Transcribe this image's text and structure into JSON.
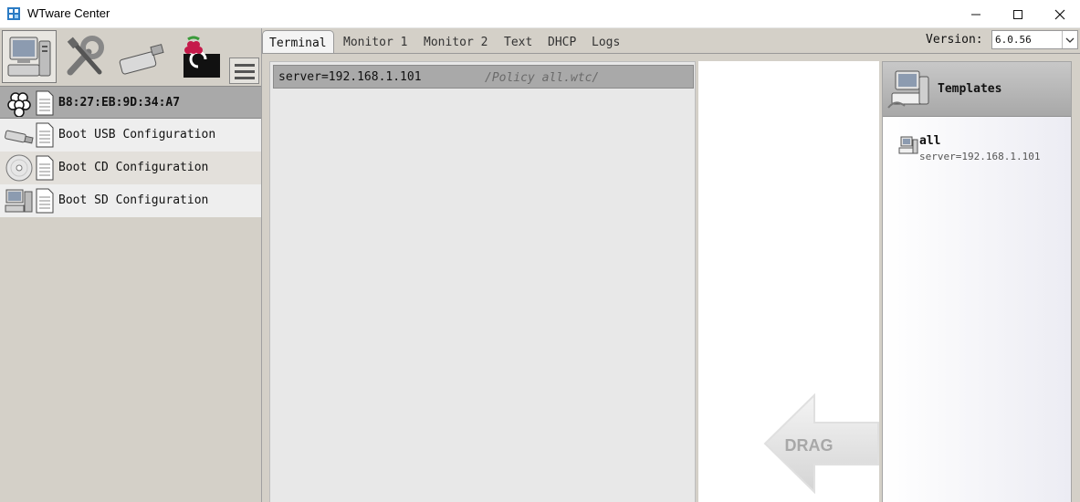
{
  "window": {
    "title": "WTware Center",
    "icon": "wtware-app-icon"
  },
  "toolbar": {
    "buttons": [
      {
        "name": "terminals-icon",
        "selected": true
      },
      {
        "name": "settings-tools-icon",
        "selected": false
      },
      {
        "name": "boot-usb-icon",
        "selected": false,
        "label": "BOOT USB"
      },
      {
        "name": "raspberry-sd-icon",
        "selected": false
      }
    ],
    "menu_icon": "hamburger-menu-icon"
  },
  "left_list": {
    "device": {
      "label": "B8:27:EB:9D:34:A7",
      "icon": "raspberry-pi-icon"
    },
    "configs": [
      {
        "label": "Boot USB Configuration",
        "icon": "usb-stick-icon"
      },
      {
        "label": "Boot CD Configuration",
        "icon": "cd-disc-icon"
      },
      {
        "label": "Boot SD Configuration",
        "icon": "computer-sd-icon"
      }
    ]
  },
  "tabs": [
    {
      "label": "Terminal",
      "active": true
    },
    {
      "label": "Monitor 1",
      "active": false
    },
    {
      "label": "Monitor 2",
      "active": false
    },
    {
      "label": "Text",
      "active": false
    },
    {
      "label": "DHCP",
      "active": false
    },
    {
      "label": "Logs",
      "active": false
    }
  ],
  "version": {
    "label": "Version:",
    "value": "6.0.56"
  },
  "policy": {
    "text": "server=192.168.1.101",
    "file": "/Policy all.wtc/"
  },
  "drag": {
    "label": "DRAG"
  },
  "templates": {
    "title": "Templates",
    "items": [
      {
        "name": "all",
        "value": "server=192.168.1.101"
      }
    ]
  }
}
